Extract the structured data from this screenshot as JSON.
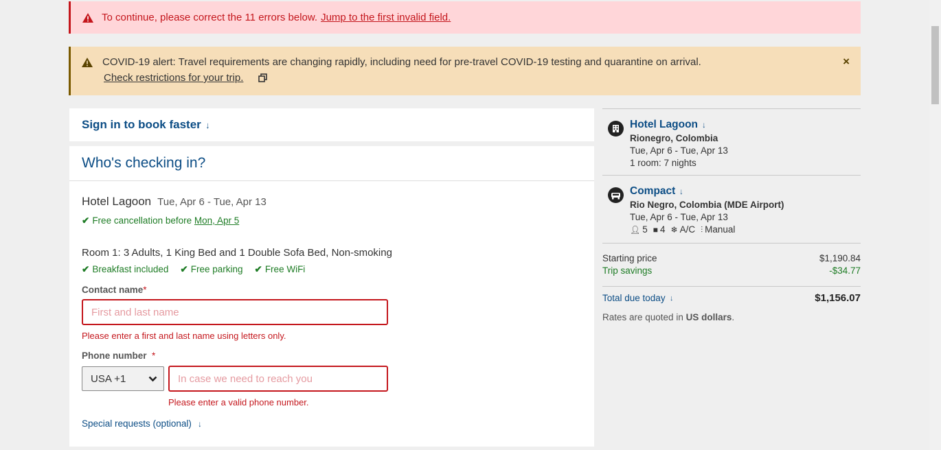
{
  "alerts": {
    "error": {
      "message": "To continue, please correct the 11 errors below.",
      "link": "Jump to the first invalid field."
    },
    "covid": {
      "message": "COVID-19 alert: Travel requirements are changing rapidly, including need for pre-travel COVID-19 testing and quarantine on arrival.",
      "link": "Check restrictions for your trip.",
      "close": "×"
    }
  },
  "signin": {
    "label": "Sign in to book faster"
  },
  "checkin": {
    "title": "Who's checking in?",
    "hotel_name": "Hotel Lagoon",
    "dates": "Tue, Apr 6 - Tue, Apr 13",
    "cancellation_text": "Free cancellation before",
    "cancellation_date": "Mon, Apr 5",
    "room": "Room 1: 3 Adults, 1 King Bed and 1 Double Sofa Bed, Non-smoking",
    "amenities": [
      "Breakfast included",
      "Free parking",
      "Free WiFi"
    ],
    "contact": {
      "label": "Contact name",
      "required": "*",
      "placeholder": "First and last name",
      "error": "Please enter a first and last name using letters only."
    },
    "phone": {
      "label": "Phone number",
      "required": "*",
      "country": "USA +1",
      "placeholder": "In case we need to reach you",
      "error": "Please enter a valid phone number."
    },
    "special_requests": "Special requests (optional)"
  },
  "summary": {
    "hotel": {
      "name": "Hotel Lagoon",
      "location": "Rionegro, Colombia",
      "dates": "Tue, Apr 6 - Tue, Apr 13",
      "rooms": "1 room: 7 nights"
    },
    "car": {
      "name": "Compact",
      "location": "Rio Negro, Colombia (MDE Airport)",
      "dates": "Tue, Apr 6 - Tue, Apr 13",
      "passengers": "5",
      "bags": "4",
      "ac": "A/C",
      "transmission": "Manual"
    },
    "price": {
      "starting_label": "Starting price",
      "starting_value": "$1,190.84",
      "savings_label": "Trip savings",
      "savings_value": "-$34.77",
      "total_label": "Total due today",
      "total_value": "$1,156.07",
      "rates_prefix": "Rates are quoted in",
      "rates_currency": "US dollars",
      "rates_suffix": "."
    }
  },
  "colors": {
    "accent": "#0c4d85",
    "error": "#c4161c",
    "success": "#1e7c25",
    "warning_bg": "#f6deb9",
    "error_bg": "#ffd6d9"
  }
}
